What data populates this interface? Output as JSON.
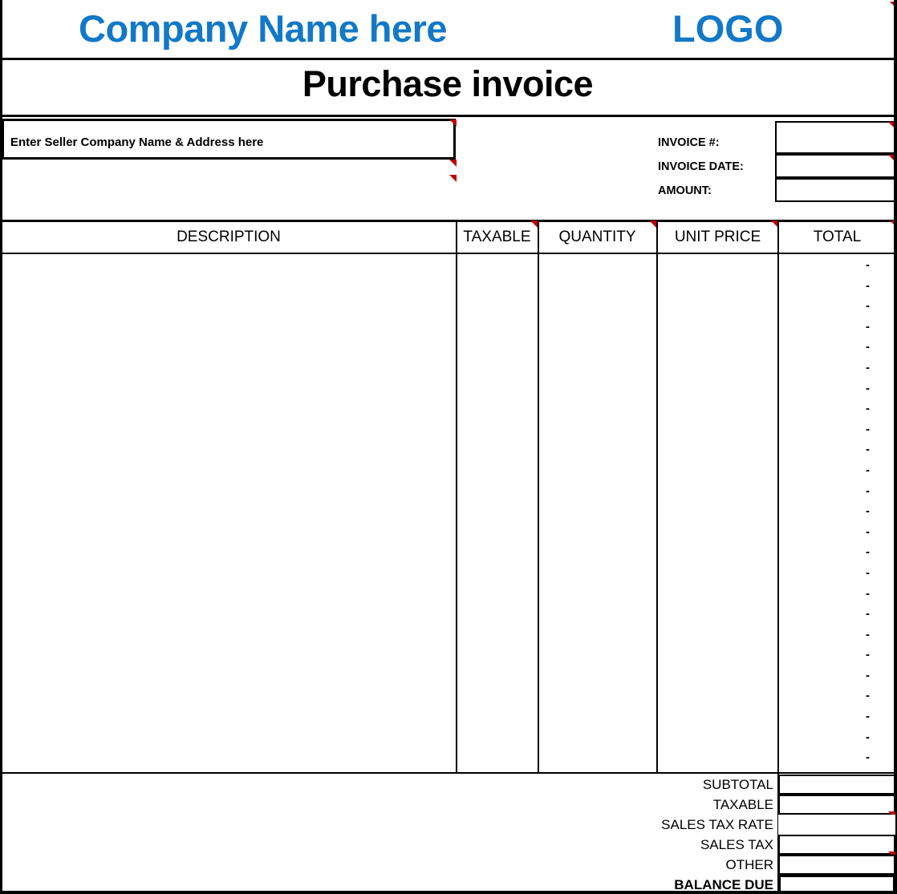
{
  "document": {
    "type": "purchase-invoice-template",
    "title": "Purchase invoice"
  },
  "banner": {
    "company_name": "Company Name here",
    "logo_placeholder": "LOGO",
    "brand_color": "#1278C8"
  },
  "seller": {
    "placeholder": "Enter Seller Company Name & Address here",
    "value": ""
  },
  "meta": {
    "fields": [
      {
        "label": "INVOICE #:",
        "value": ""
      },
      {
        "label": "INVOICE DATE:",
        "value": ""
      },
      {
        "label": "AMOUNT:",
        "value": ""
      }
    ]
  },
  "items_table": {
    "columns": [
      {
        "key": "description",
        "label": "DESCRIPTION"
      },
      {
        "key": "taxable",
        "label": "TAXABLE"
      },
      {
        "key": "quantity",
        "label": "QUANTITY"
      },
      {
        "key": "unit_price",
        "label": "UNIT PRICE"
      },
      {
        "key": "total",
        "label": "TOTAL"
      }
    ],
    "empty_total_glyph": "-",
    "row_count": 25,
    "rows": []
  },
  "totals": {
    "rows": [
      {
        "label": "SUBTOTAL",
        "value": "",
        "bold": false,
        "boxed": true
      },
      {
        "label": "TAXABLE",
        "value": "",
        "bold": false,
        "boxed": true
      },
      {
        "label": "SALES TAX RATE",
        "value": "",
        "bold": false,
        "boxed": false
      },
      {
        "label": "SALES TAX",
        "value": "",
        "bold": false,
        "boxed": true
      },
      {
        "label": "OTHER",
        "value": "",
        "bold": false,
        "boxed": true
      },
      {
        "label": "BALANCE DUE",
        "value": "",
        "bold": true,
        "boxed": true
      }
    ]
  },
  "annotations": {
    "comment_marker": "red-comment-triangle",
    "comment_marker_color": "#C00000"
  }
}
